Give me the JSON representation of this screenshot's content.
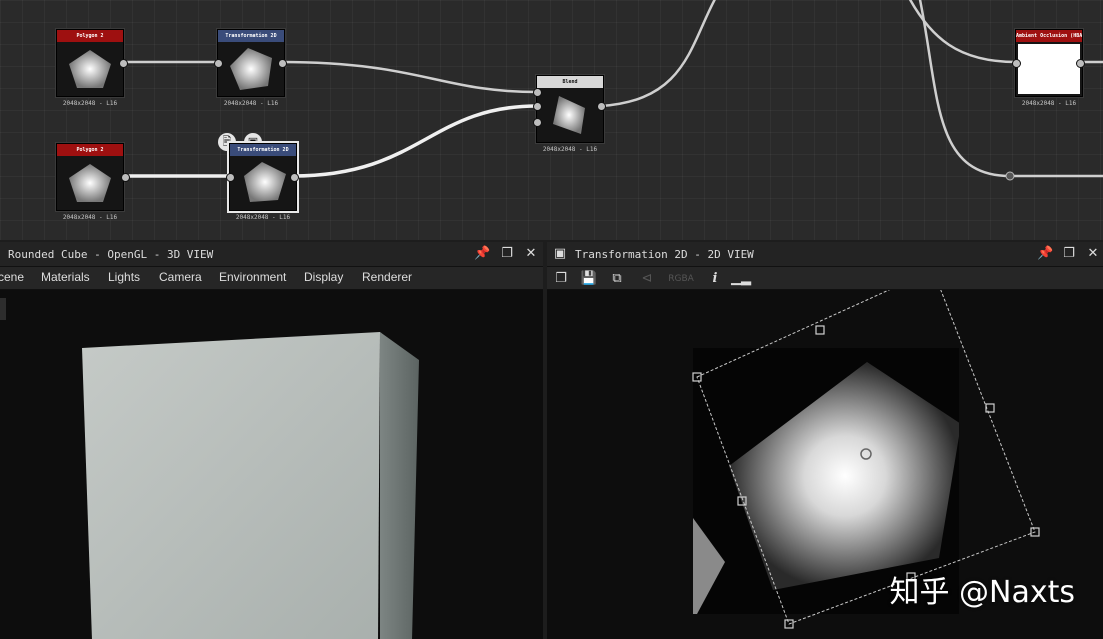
{
  "graph": {
    "nodes": [
      {
        "id": "polygon1",
        "title": "Polygon 2",
        "resolution": "2048x2048 - L16"
      },
      {
        "id": "transform1",
        "title": "Transformation 2D",
        "resolution": "2048x2048 - L16"
      },
      {
        "id": "polygon2",
        "title": "Polygon 2",
        "resolution": "2048x2048 - L16"
      },
      {
        "id": "transform2",
        "title": "Transformation 2D",
        "resolution": "2048x2048 - L16"
      },
      {
        "id": "blend",
        "title": "Blend",
        "resolution": "2048x2048 - L16"
      },
      {
        "id": "ao",
        "title": "Ambient Occlusion (HBAO)",
        "resolution": "2048x2048 - L16"
      }
    ],
    "colors": {
      "polygon_header": "#9e1010",
      "transform_header": "#3a4c7a",
      "blend_header": "#d7d7d7",
      "ao_header": "#9e1010",
      "wire": "#cfcfcf"
    }
  },
  "panel3d": {
    "title": "Rounded Cube - OpenGL - 3D VIEW",
    "menu": [
      "Scene",
      "Materials",
      "Lights",
      "Camera",
      "Environment",
      "Display",
      "Renderer"
    ],
    "menu_first_visible": "cene",
    "header_icons": [
      "pin-icon",
      "restore-icon",
      "close-icon"
    ]
  },
  "panel2d": {
    "title": "Transformation 2D - 2D VIEW",
    "toolbar": [
      "copy-icon",
      "save-icon",
      "duplicate-icon",
      "share-icon",
      "channel-select",
      "info-icon",
      "histogram-icon"
    ],
    "channel_label": "RGBA",
    "header_icons": [
      "pin-icon",
      "restore-icon",
      "close-icon"
    ]
  },
  "watermark": "知乎 @Naxts"
}
